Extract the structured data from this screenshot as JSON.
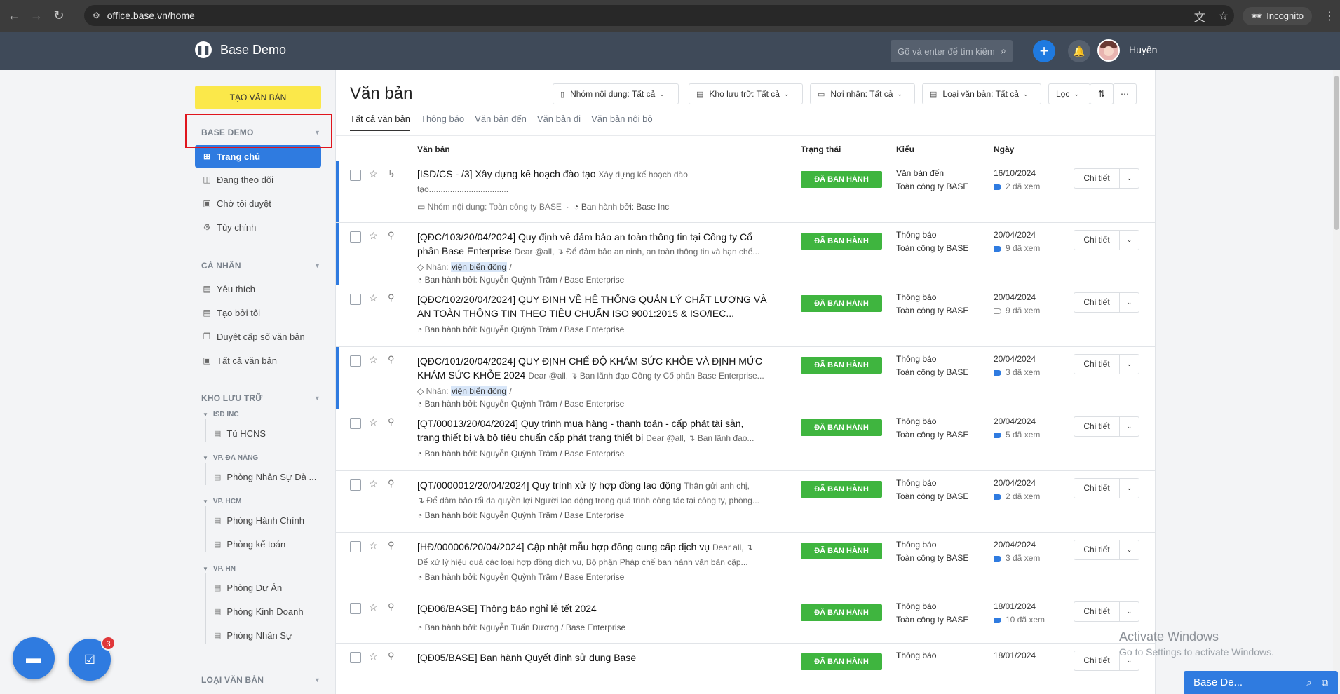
{
  "browser": {
    "url": "office.base.vn/home",
    "incognito_label": "Incognito"
  },
  "app": {
    "title": "Base Demo",
    "search_placeholder": "Gõ và enter để tìm kiếm",
    "user_name": "Huyền"
  },
  "sidebar": {
    "create_label": "TẠO VĂN BẢN",
    "sec_base": "BASE DEMO",
    "base_items": [
      "Trang chủ",
      "Đang theo dõi",
      "Chờ tôi duyệt",
      "Tùy chỉnh"
    ],
    "sec_personal": "CÁ NHÂN",
    "personal_items": [
      "Yêu thích",
      "Tạo bởi tôi",
      "Duyệt cấp số văn bản",
      "Tất cả văn bản"
    ],
    "sec_storage": "KHO LƯU TRỮ",
    "storage": [
      {
        "group": "ISD INC",
        "items": [
          "Tủ HCNS"
        ]
      },
      {
        "group": "VP. ĐÀ NẴNG",
        "items": [
          "Phòng Nhân Sự Đà ..."
        ]
      },
      {
        "group": "VP. HCM",
        "items": [
          "Phòng Hành Chính",
          "Phòng kế toán"
        ]
      },
      {
        "group": "VP. HN",
        "items": [
          "Phòng Dự Án",
          "Phòng Kinh Doanh",
          "Phòng Nhân Sự"
        ]
      }
    ],
    "sec_types": "LOẠI VĂN BẢN",
    "task_badge": "3"
  },
  "main": {
    "title": "Văn bản",
    "filters": [
      "Nhóm nội dung: Tất cả",
      "Kho lưu trữ: Tất cả",
      "Nơi nhận: Tất cả",
      "Loại văn bản: Tất cả",
      "Lọc"
    ],
    "tabs": [
      "Tất cả văn bản",
      "Thông báo",
      "Văn bản đến",
      "Văn bản đi",
      "Văn bản nội bộ"
    ],
    "columns": [
      "Văn bản",
      "Trạng thái",
      "Kiểu",
      "Ngày"
    ],
    "detail_label": "Chi tiết",
    "status_label": "ĐÃ BAN HÀNH",
    "rows": [
      {
        "title": "[ISD/CS - /3] Xây dựng kế hoạch đào tạo",
        "title2": "",
        "preview": "Xây dựng kế hoạch đào",
        "line2": "tạo..................................",
        "meta1": "Nhóm nội dung: Toàn công ty BASE",
        "meta1b": "Ban hành bởi: Base Inc",
        "meta2": "",
        "tag": "",
        "type": "Văn bản đến",
        "dept": "Toàn công ty BASE",
        "date": "16/10/2024",
        "views": "2 đã xem"
      },
      {
        "title": "[QĐC/103/20/04/2024] Quy định về đảm bảo an toàn thông tin tại Công ty Cổ",
        "title2": "phần Base Enterprise",
        "preview": "Dear @all, ↴ Để đảm bảo an ninh, an toàn thông tin và hạn chế...",
        "line2": "",
        "meta1": "Nhãn:",
        "tag": "viện biển đông",
        "meta2": "Ban hành bởi: Nguyễn Quỳnh Trâm / Base Enterprise",
        "type": "Thông báo",
        "dept": "Toàn công ty BASE",
        "date": "20/04/2024",
        "views": "9 đã xem"
      },
      {
        "title": "[QĐC/102/20/04/2024] QUY ĐỊNH VỀ HỆ THỐNG QUẢN LÝ CHẤT LƯỢNG VÀ",
        "title2": "AN TOÀN THÔNG TIN THEO TIÊU CHUẨN ISO 9001:2015 & ISO/IEC...",
        "preview": "",
        "line2": "",
        "meta1": "",
        "tag": "",
        "meta2": "Ban hành bởi: Nguyễn Quỳnh Trâm / Base Enterprise",
        "type": "Thông báo",
        "dept": "Toàn công ty BASE",
        "date": "20/04/2024",
        "views": "9 đã xem"
      },
      {
        "title": "[QĐC/101/20/04/2024] QUY ĐỊNH CHẾ ĐỘ KHÁM SỨC KHỎE VÀ ĐỊNH MỨC",
        "title2": "KHÁM SỨC KHỎE 2024",
        "preview": "Dear @all, ↴ Ban lãnh đạo Công ty Cổ phần Base Enterprise...",
        "line2": "",
        "meta1": "Nhãn:",
        "tag": "viện biển đông",
        "meta2": "Ban hành bởi: Nguyễn Quỳnh Trâm / Base Enterprise",
        "type": "Thông báo",
        "dept": "Toàn công ty BASE",
        "date": "20/04/2024",
        "views": "3 đã xem"
      },
      {
        "title": "[QT/00013/20/04/2024] Quy trình mua hàng - thanh toán - cấp phát tài sản,",
        "title2": "trang thiết bị và bộ tiêu chuẩn cấp phát trang thiết bị",
        "preview": "Dear @all, ↴ Ban lãnh đạo...",
        "line2": "",
        "meta1": "",
        "tag": "",
        "meta2": "Ban hành bởi: Nguyễn Quỳnh Trâm / Base Enterprise",
        "type": "Thông báo",
        "dept": "Toàn công ty BASE",
        "date": "20/04/2024",
        "views": "5 đã xem"
      },
      {
        "title": "[QT/0000012/20/04/2024] Quy trình xử lý hợp đồng lao động",
        "title2": "",
        "preview": "Thân gửi anh chị,",
        "line2": "↴ Để đảm bảo tối đa quyền lợi Người lao động trong quá trình công tác tại công ty, phòng...",
        "meta1": "",
        "tag": "",
        "meta2": "Ban hành bởi: Nguyễn Quỳnh Trâm / Base Enterprise",
        "type": "Thông báo",
        "dept": "Toàn công ty BASE",
        "date": "20/04/2024",
        "views": "2 đã xem"
      },
      {
        "title": "[HĐ/000006/20/04/2024] Cập nhật mẫu hợp đồng cung cấp dịch vụ",
        "title2": "",
        "preview": "Dear all, ↴",
        "line2": "Để xử lý hiệu quả các loại hợp đồng dịch vụ, Bộ phận Pháp chế ban hành văn bản cập...",
        "meta1": "",
        "tag": "",
        "meta2": "Ban hành bởi: Nguyễn Quỳnh Trâm / Base Enterprise",
        "type": "Thông báo",
        "dept": "Toàn công ty BASE",
        "date": "20/04/2024",
        "views": "3 đã xem"
      },
      {
        "title": "[QĐ06/BASE] Thông báo nghỉ lễ tết 2024",
        "title2": "",
        "preview": "",
        "line2": "",
        "meta1": "",
        "tag": "",
        "meta2": "Ban hành bởi: Nguyễn Tuấn Dương / Base Enterprise",
        "type": "Thông báo",
        "dept": "Toàn công ty BASE",
        "date": "18/01/2024",
        "views": "10 đã xem"
      },
      {
        "title": "[QĐ05/BASE] Ban hành Quyết định sử dụng Base",
        "title2": "",
        "preview": "",
        "line2": "",
        "meta1": "",
        "tag": "",
        "meta2": "",
        "type": "Thông báo",
        "dept": "",
        "date": "18/01/2024",
        "views": ""
      }
    ]
  },
  "windows": {
    "watermark1": "Activate Windows",
    "watermark2": "Go to Settings to activate Windows."
  },
  "chat": {
    "label": "Base De..."
  }
}
